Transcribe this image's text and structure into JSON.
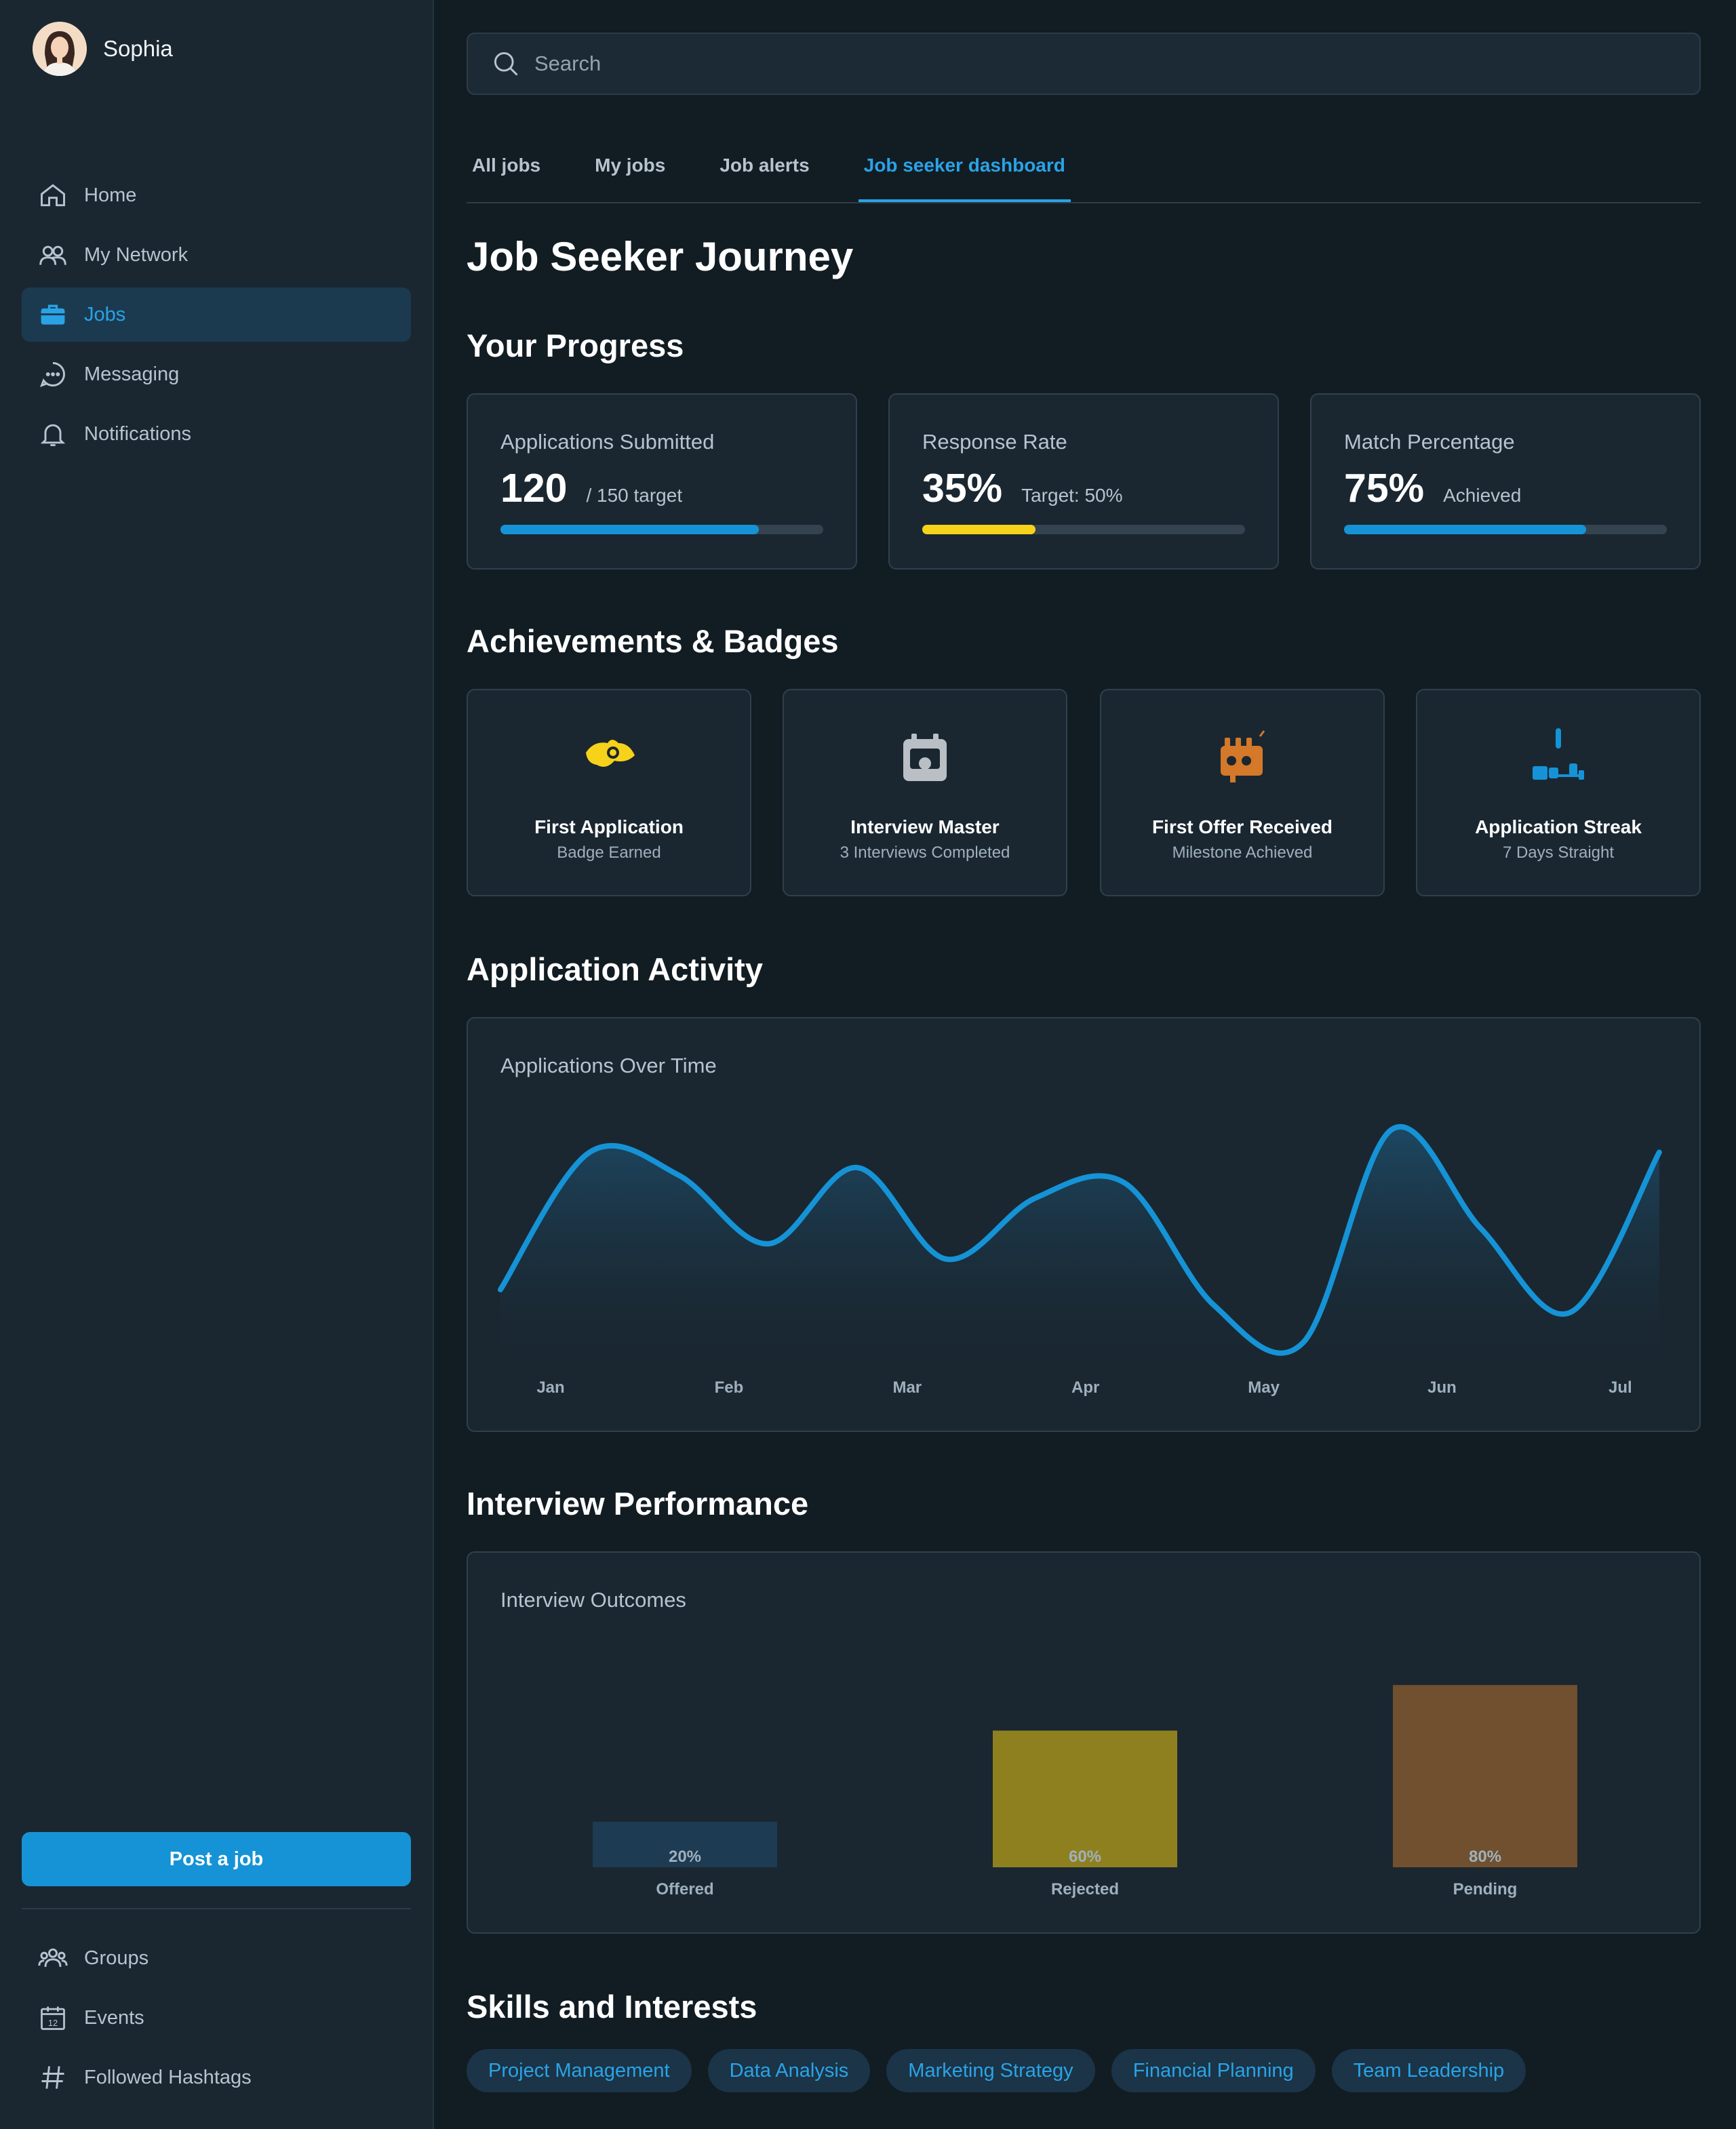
{
  "user": {
    "name": "Sophia"
  },
  "nav": [
    {
      "label": "Home",
      "icon": "home-icon"
    },
    {
      "label": "My Network",
      "icon": "network-icon"
    },
    {
      "label": "Jobs",
      "icon": "briefcase-icon"
    },
    {
      "label": "Messaging",
      "icon": "chat-icon"
    },
    {
      "label": "Notifications",
      "icon": "bell-icon"
    }
  ],
  "post_job": "Post a job",
  "nav_bottom": [
    {
      "label": "Groups",
      "icon": "groups-icon"
    },
    {
      "label": "Events",
      "icon": "calendar-icon"
    },
    {
      "label": "Followed Hashtags",
      "icon": "hashtag-icon"
    }
  ],
  "search": {
    "placeholder": "Search"
  },
  "tabs": [
    "All jobs",
    "My jobs",
    "Job alerts",
    "Job seeker dashboard"
  ],
  "page_title": "Job Seeker Journey",
  "sections": {
    "progress": "Your Progress",
    "achievements": "Achievements & Badges",
    "activity": "Application Activity",
    "interview": "Interview Performance",
    "skills": "Skills and Interests"
  },
  "stats": [
    {
      "label": "Applications Submitted",
      "value": "120",
      "sub": "/ 150 target",
      "progress": 0.8,
      "color": "#1593d6"
    },
    {
      "label": "Response Rate",
      "value": "35%",
      "sub": "Target: 50%",
      "progress": 0.35,
      "color": "#f7d21a"
    },
    {
      "label": "Match Percentage",
      "value": "75%",
      "sub": "Achieved",
      "progress": 0.75,
      "color": "#1593d6"
    }
  ],
  "badges": [
    {
      "title": "First Application",
      "sub": "Badge Earned",
      "icon": "first-application-badge-icon",
      "color": "#f7d21a"
    },
    {
      "title": "Interview Master",
      "sub": "3 Interviews Completed",
      "icon": "interview-master-badge-icon",
      "color": "#b9bfc4"
    },
    {
      "title": "First Offer Received",
      "sub": "Milestone Achieved",
      "icon": "first-offer-badge-icon",
      "color": "#d4782a"
    },
    {
      "title": "Application Streak",
      "sub": "7 Days Straight",
      "icon": "application-streak-badge-icon",
      "color": "#1593d6"
    }
  ],
  "chart_data": [
    {
      "type": "area",
      "title": "Applications Over Time",
      "categories": [
        "Jan",
        "Feb",
        "Mar",
        "Apr",
        "May",
        "Jun",
        "Jul"
      ],
      "x": [
        0,
        0.5,
        1,
        1.5,
        2,
        2.5,
        3,
        3.5,
        4,
        4.5,
        5,
        5.5,
        6,
        6.5
      ],
      "values": [
        8,
        26,
        23,
        14,
        24,
        12,
        20,
        22,
        6,
        1,
        29,
        16,
        5,
        26
      ],
      "ylim": [
        0,
        32
      ],
      "color": "#1593d6"
    },
    {
      "type": "bar",
      "title": "Interview Outcomes",
      "categories": [
        "Offered",
        "Rejected",
        "Pending"
      ],
      "values": [
        20,
        60,
        80
      ],
      "labels": [
        "20%",
        "60%",
        "80%"
      ],
      "colors": [
        "#1d3b52",
        "#8e801f",
        "#70502f"
      ],
      "ylim": [
        0,
        100
      ]
    }
  ],
  "skills": [
    "Project Management",
    "Data Analysis",
    "Marketing Strategy",
    "Financial Planning",
    "Team Leadership"
  ]
}
